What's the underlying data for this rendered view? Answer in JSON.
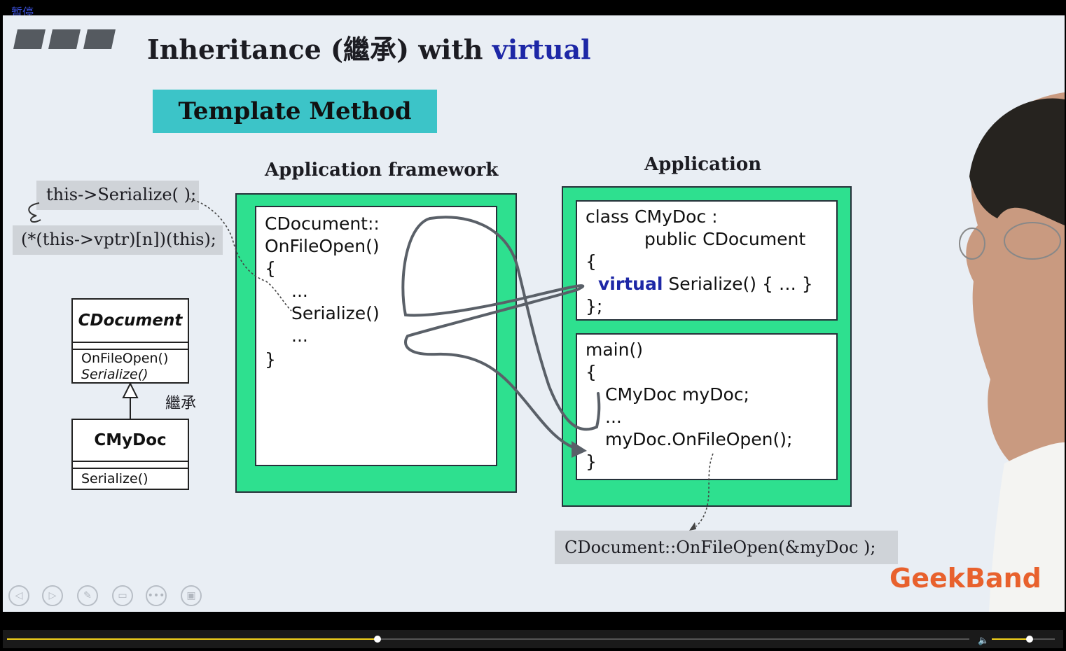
{
  "player": {
    "status_label": "暂停",
    "progress_fraction": 0.385,
    "volume_fraction": 0.6
  },
  "slide": {
    "title_part1": "Inheritance (繼承) with ",
    "title_kw": "virtual",
    "pattern_name": "Template Method",
    "framework_label": "Application framework",
    "application_label": "Application",
    "note_this_call": "this->Serialize( );",
    "note_vptr": "(*(this->vptr)[n])(this);",
    "note_bottom": "CDocument::OnFileOpen(&myDoc );",
    "framework_code": {
      "l1": "CDocument::",
      "l2": "OnFileOpen()",
      "l3": "{",
      "l4": "...",
      "l5": "Serialize()",
      "l6": "...",
      "l7": "}"
    },
    "class_code": {
      "l1": "class CMyDoc :",
      "l2": "public CDocument",
      "l3": "{",
      "kw": "virtual",
      "l4": " Serialize() { … }",
      "l5": "};"
    },
    "main_code": {
      "l1": "main()",
      "l2": "{",
      "l3": "CMyDoc myDoc;",
      "l4": "...",
      "l5": "myDoc.OnFileOpen();",
      "l6": "}"
    },
    "uml": {
      "base_name": "CDocument",
      "base_m1": "OnFileOpen()",
      "base_m2": "Serialize()",
      "inherit_label": "繼承",
      "derived_name": "CMyDoc",
      "derived_m1": "Serialize()"
    },
    "watermark": "GeekBand"
  },
  "colors": {
    "teal": "#3cc4c8",
    "green": "#2ee08f",
    "keyword_blue": "#1d27a6",
    "brand_orange": "#e8612d",
    "progress_yellow": "#f2d21b"
  }
}
